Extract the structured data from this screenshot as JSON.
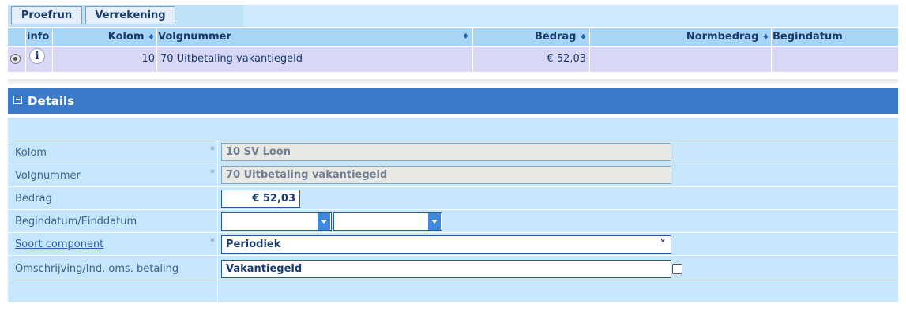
{
  "toolbar": {
    "proefrun_label": "Proefrun",
    "verrekening_label": "Verrekening"
  },
  "grid": {
    "columns": {
      "info": "info",
      "kolom": "Kolom",
      "volgnummer": "Volgnummer",
      "bedrag": "Bedrag",
      "normbedrag": "Normbedrag",
      "begindatum": "Begindatum"
    },
    "sort_glyph": "♦",
    "rows": [
      {
        "selected": true,
        "kolom": "10",
        "volgnummer": "70 Uitbetaling vakantiegeld",
        "bedrag": "€ 52,03",
        "normbedrag": "",
        "begindatum": ""
      }
    ]
  },
  "details": {
    "toggle_symbol": "−",
    "title": "Details",
    "required_marker": "*",
    "fields": {
      "kolom": {
        "label": "Kolom",
        "value": "10 SV Loon"
      },
      "volgnummer": {
        "label": "Volgnummer",
        "value": "70 Uitbetaling vakantiegeld"
      },
      "bedrag": {
        "label": "Bedrag",
        "value": "€ 52,03"
      },
      "datum": {
        "label": "Begindatum/Einddatum",
        "begin": "",
        "eind": ""
      },
      "soort": {
        "label": "Soort component",
        "value": "Periodiek",
        "chevron": "⌄"
      },
      "omschrijving": {
        "label": "Omschrijving/Ind. oms. betaling",
        "value": "Vakantiegeld",
        "checked": false
      }
    }
  },
  "colors": {
    "header_bar": "#3b7ac8",
    "grid_header": "#a6d5f5",
    "selected_row": "#d8d8f6",
    "panel": "#c5e6fb"
  }
}
